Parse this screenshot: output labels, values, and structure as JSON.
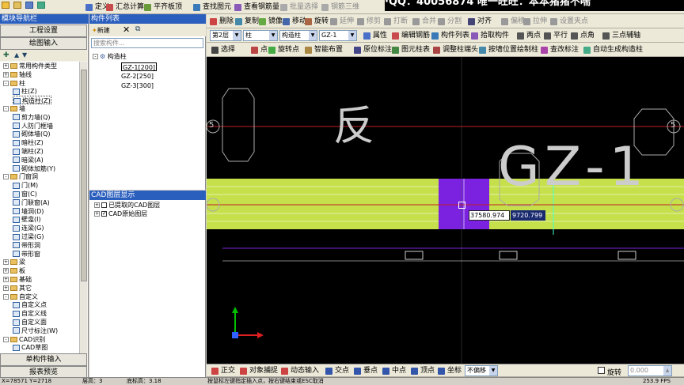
{
  "overlay_text": "·QQ：40056874 唯一旺旺：本本猪猪不喘",
  "top_toolbar": {
    "items": [
      "定义",
      "汇总计算",
      "平齐板顶",
      "查找图元",
      "查看钢筋量",
      "批量选择",
      "钢筋三维"
    ],
    "right_items": [
      "删除",
      "复制",
      "镜像",
      "移动",
      "旋转",
      "延伸",
      "修剪",
      "打断",
      "合并",
      "分割",
      "对齐",
      "偏移",
      "拉伸",
      "设置夹点"
    ]
  },
  "module_nav": {
    "title": "模块导航栏",
    "buttons": [
      "工程设置",
      "绘图输入"
    ],
    "tree": [
      {
        "label": "常用构件类型",
        "depth": 0,
        "exp": "+"
      },
      {
        "label": "轴线",
        "depth": 0,
        "exp": "+"
      },
      {
        "label": "柱",
        "depth": 0,
        "exp": "-"
      },
      {
        "label": "柱(Z)",
        "depth": 1
      },
      {
        "label": "构造柱(Z)",
        "depth": 1,
        "selected": true
      },
      {
        "label": "墙",
        "depth": 0,
        "exp": "-"
      },
      {
        "label": "剪力墙(Q)",
        "depth": 1
      },
      {
        "label": "人防门框墙",
        "depth": 1
      },
      {
        "label": "砌体墙(Q)",
        "depth": 1
      },
      {
        "label": "暗柱(Z)",
        "depth": 1
      },
      {
        "label": "端柱(Z)",
        "depth": 1
      },
      {
        "label": "暗梁(A)",
        "depth": 1
      },
      {
        "label": "砌体加筋(Y)",
        "depth": 1
      },
      {
        "label": "门窗洞",
        "depth": 0,
        "exp": "-"
      },
      {
        "label": "门(M)",
        "depth": 1
      },
      {
        "label": "窗(C)",
        "depth": 1
      },
      {
        "label": "门联窗(A)",
        "depth": 1
      },
      {
        "label": "墙洞(D)",
        "depth": 1
      },
      {
        "label": "壁龛(I)",
        "depth": 1
      },
      {
        "label": "连梁(G)",
        "depth": 1
      },
      {
        "label": "过梁(G)",
        "depth": 1
      },
      {
        "label": "带形洞",
        "depth": 1
      },
      {
        "label": "带形窗",
        "depth": 1
      },
      {
        "label": "梁",
        "depth": 0,
        "exp": "+"
      },
      {
        "label": "板",
        "depth": 0,
        "exp": "+"
      },
      {
        "label": "基础",
        "depth": 0,
        "exp": "+"
      },
      {
        "label": "其它",
        "depth": 0,
        "exp": "+"
      },
      {
        "label": "自定义",
        "depth": 0,
        "exp": "-"
      },
      {
        "label": "自定义点",
        "depth": 1
      },
      {
        "label": "自定义线",
        "depth": 1
      },
      {
        "label": "自定义面",
        "depth": 1
      },
      {
        "label": "尺寸标注(W)",
        "depth": 1
      },
      {
        "label": "CAD识别",
        "depth": 0,
        "exp": "-"
      },
      {
        "label": "CAD草图",
        "depth": 1
      }
    ],
    "bottom_buttons": [
      "单构件输入",
      "报表预览"
    ]
  },
  "component_list": {
    "title": "构件列表",
    "new_label": "新建",
    "search_placeholder": "搜索构件...",
    "root": "构造柱",
    "items": [
      "GZ-1[200]",
      "GZ-2[250]",
      "GZ-3[300]"
    ]
  },
  "cad_layer": {
    "title": "CAD图层显示",
    "items": [
      {
        "label": "已提取的CAD图层",
        "checked": false
      },
      {
        "label": "CAD原始图层",
        "checked": true
      }
    ]
  },
  "prop_bar": {
    "floor": "第2层",
    "type": "柱",
    "subtype": "构造柱",
    "name": "GZ-1",
    "buttons": [
      "属性",
      "编辑钢筋",
      "构件列表",
      "拾取构件"
    ],
    "draw_buttons": [
      "两点",
      "平行",
      "点角",
      "三点辅轴"
    ]
  },
  "draw_bar": {
    "buttons": [
      "选择",
      "点",
      "旋转点",
      "智能布置",
      "原位标注",
      "图元柱表",
      "调整柱端头",
      "按墙位置绘制柱",
      "查改标注",
      "自动生成构造柱"
    ]
  },
  "canvas": {
    "text_a": "反",
    "text_gz": "GZ-1",
    "axis_label": "5",
    "coord_x": "37580.974",
    "coord_y": "9720.799"
  },
  "snap_bar": {
    "items": [
      "正交",
      "对象捕捉",
      "动态输入",
      "交点",
      "垂点",
      "中点",
      "顶点",
      "坐标"
    ],
    "mode": "不偏移",
    "rotate_label": "旋转",
    "rotate_value": "0.000"
  },
  "statusbar": {
    "coords": "X=78571 Y=2718",
    "floor_label": "层高：3",
    "bottom_label": "底标高：3.18",
    "hint": "按鼠标左键指定插入点，按右键结束或ESC取消",
    "fps": "253.9 FPS"
  }
}
